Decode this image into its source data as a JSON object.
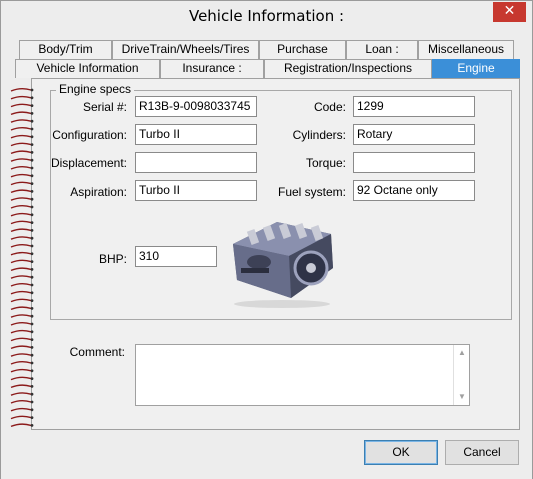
{
  "window": {
    "title": "Vehicle Information :",
    "close_glyph": "✕"
  },
  "tabs_row1": [
    {
      "label": "Body/Trim"
    },
    {
      "label": "DriveTrain/Wheels/Tires"
    },
    {
      "label": "Purchase"
    },
    {
      "label": "Loan :"
    },
    {
      "label": "Miscellaneous"
    }
  ],
  "tabs_row2": [
    {
      "label": "Vehicle Information"
    },
    {
      "label": "Insurance :"
    },
    {
      "label": "Registration/Inspections"
    },
    {
      "label": "Engine",
      "active": true
    }
  ],
  "engine_specs": {
    "group_title": "Engine specs",
    "serial_label": "Serial #:",
    "serial_value": "R13B-9-0098033745",
    "code_label": "Code:",
    "code_value": "1299",
    "configuration_label": "Configuration:",
    "configuration_value": "Turbo II",
    "cylinders_label": "Cylinders:",
    "cylinders_value": "Rotary",
    "displacement_label": "Displacement:",
    "displacement_value": "",
    "torque_label": "Torque:",
    "torque_value": "",
    "aspiration_label": "Aspiration:",
    "aspiration_value": "Turbo II",
    "fuel_label": "Fuel system:",
    "fuel_value": "92 Octane only",
    "bhp_label": "BHP:",
    "bhp_value": "310"
  },
  "comment": {
    "label": "Comment:",
    "value": ""
  },
  "buttons": {
    "ok": "OK",
    "cancel": "Cancel"
  },
  "colors": {
    "active_tab": "#3b8fd8",
    "close_button": "#c7382f",
    "spiral": "#8b1a1a"
  }
}
